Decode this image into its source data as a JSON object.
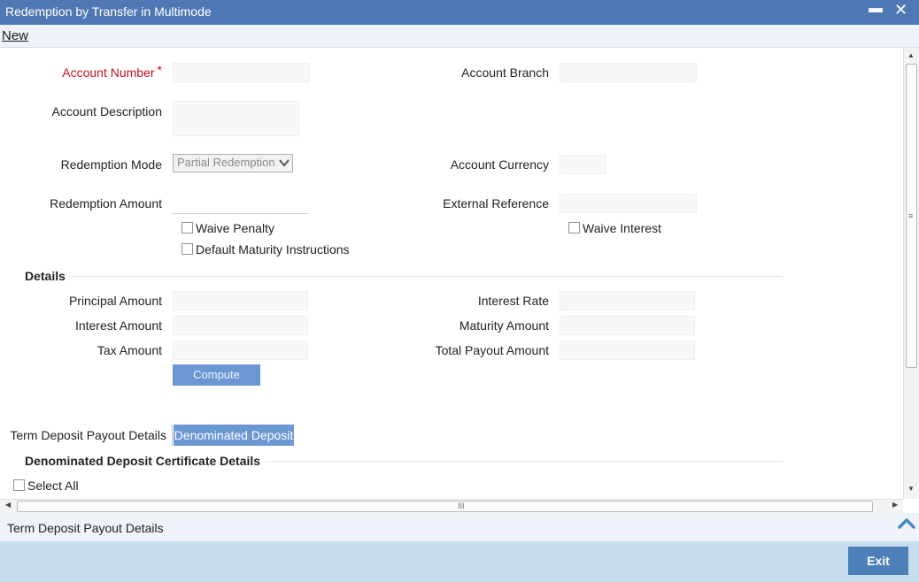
{
  "window": {
    "title": "Redemption by Transfer in Multimode",
    "minimize_glyph": "▬",
    "close_glyph": "✕"
  },
  "menu": {
    "new_label": "New"
  },
  "form": {
    "account_number_label": "Account Number",
    "required_marker": "*",
    "account_branch_label": "Account Branch",
    "account_description_label": "Account Description",
    "redemption_mode_label": "Redemption Mode",
    "redemption_mode_value": "Partial Redemption",
    "account_currency_label": "Account Currency",
    "redemption_amount_label": "Redemption Amount",
    "external_reference_label": "External Reference",
    "waive_penalty_label": "Waive Penalty",
    "waive_penalty_checked": false,
    "waive_interest_label": "Waive Interest",
    "waive_interest_checked": false,
    "default_maturity_label": "Default Maturity Instructions",
    "default_maturity_checked": false
  },
  "details": {
    "section_title": "Details",
    "principal_amount_label": "Principal Amount",
    "interest_rate_label": "Interest Rate",
    "interest_amount_label": "Interest Amount",
    "maturity_amount_label": "Maturity Amount",
    "tax_amount_label": "Tax Amount",
    "total_payout_amount_label": "Total Payout Amount",
    "compute_button": "Compute"
  },
  "payout_tabs": {
    "label": "Term Deposit Payout Details",
    "tab_denominated": "Denominated Deposit"
  },
  "denominated": {
    "section_title": "Denominated Deposit Certificate Details",
    "select_all_label": "Select All",
    "select_all_checked": false
  },
  "scrollbars": {
    "grip_glyph": "III",
    "up": "▲",
    "down": "▼",
    "left": "◀",
    "right": "▶"
  },
  "footer": {
    "tab_label": "Term Deposit Payout Details",
    "exit_button": "Exit"
  }
}
